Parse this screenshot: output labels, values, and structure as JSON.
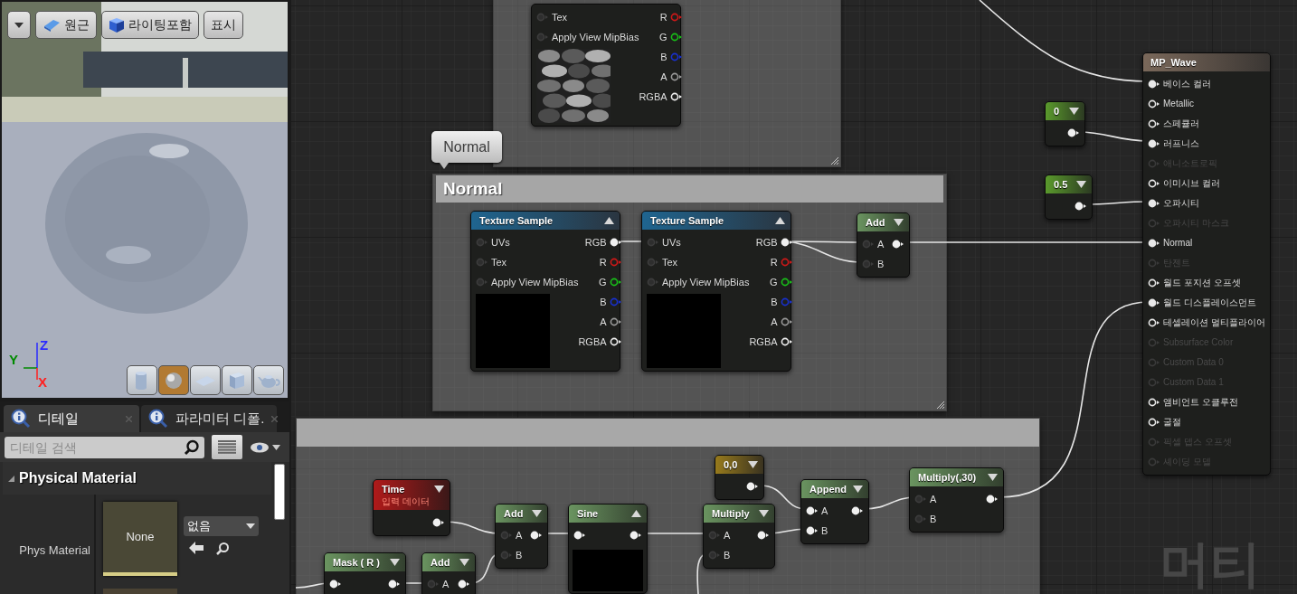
{
  "viewport": {
    "toolbar": [
      {
        "kind": "menu"
      },
      {
        "kind": "perspective",
        "label": "원근"
      },
      {
        "kind": "lit",
        "label": "라이팅포함"
      },
      {
        "kind": "show",
        "label": "표시"
      }
    ],
    "axes": [
      {
        "label": "Z",
        "color": "#2a2aff"
      },
      {
        "label": "Y",
        "color": "#008a00"
      },
      {
        "label": "X",
        "color": "#ff2020"
      }
    ],
    "preview_shapes": [
      {
        "kind": "cylinder",
        "selected": false
      },
      {
        "kind": "sphere",
        "selected": true
      },
      {
        "kind": "plane",
        "selected": false
      },
      {
        "kind": "cube",
        "selected": false
      },
      {
        "kind": "teapot",
        "selected": false
      }
    ]
  },
  "details": {
    "tabs": [
      {
        "label": "디테일",
        "selected": true
      },
      {
        "label": "파라미터 디폴.",
        "selected": false
      }
    ],
    "search": {
      "placeholder": "디테일 검색"
    },
    "section": {
      "title": "Physical Material",
      "expanded": true
    },
    "properties": [
      {
        "label": "Phys Material",
        "thumbnail": "None",
        "value": "없음"
      }
    ]
  },
  "graph": {
    "comments": [
      {
        "kind": "comment"
      },
      {
        "kind": "comment",
        "title": "Normal"
      },
      {
        "kind": "comment"
      }
    ],
    "bubble": "Normal",
    "nodes": [
      {
        "kind": "texture",
        "expanded": true,
        "inputs": [
          {
            "label": "Tex",
            "filled": false
          },
          {
            "label": "Apply View MipBias",
            "filled": false
          }
        ],
        "outputs": [
          {
            "label": "R",
            "filled": false,
            "color": "#d01818"
          },
          {
            "label": "G",
            "filled": false,
            "color": "#18c018"
          },
          {
            "label": "B",
            "filled": false,
            "color": "#1830d0"
          },
          {
            "label": "A",
            "filled": false,
            "color": "#9a9a9a"
          },
          {
            "label": "RGBA",
            "filled": false,
            "color": "#f0f0f0"
          }
        ]
      },
      {
        "kind": "texture",
        "title": "Texture Sample",
        "expanded": true,
        "inputs": [
          {
            "label": "UVs",
            "filled": false
          },
          {
            "label": "Tex",
            "filled": false
          },
          {
            "label": "Apply View MipBias",
            "filled": false
          }
        ],
        "outputs": [
          {
            "label": "RGB",
            "filled": true,
            "color": "#f0f0f0"
          },
          {
            "label": "R",
            "filled": false,
            "color": "#d01818"
          },
          {
            "label": "G",
            "filled": false,
            "color": "#18c018"
          },
          {
            "label": "B",
            "filled": false,
            "color": "#1830d0"
          },
          {
            "label": "A",
            "filled": false,
            "color": "#9a9a9a"
          },
          {
            "label": "RGBA",
            "filled": false,
            "color": "#f0f0f0"
          }
        ]
      },
      {
        "kind": "texture",
        "title": "Texture Sample",
        "expanded": true,
        "inputs": [
          {
            "label": "UVs",
            "filled": false
          },
          {
            "label": "Tex",
            "filled": false
          },
          {
            "label": "Apply View MipBias",
            "filled": false
          }
        ],
        "outputs": [
          {
            "label": "RGB",
            "filled": true,
            "color": "#f0f0f0"
          },
          {
            "label": "R",
            "filled": false,
            "color": "#d01818"
          },
          {
            "label": "G",
            "filled": false,
            "color": "#18c018"
          },
          {
            "label": "B",
            "filled": false,
            "color": "#1830d0"
          },
          {
            "label": "A",
            "filled": false,
            "color": "#9a9a9a"
          },
          {
            "label": "RGBA",
            "filled": false,
            "color": "#f0f0f0"
          }
        ]
      },
      {
        "kind": "math",
        "title": "Add",
        "expanded": false,
        "inputs": [
          {
            "label": "A",
            "filled": false
          },
          {
            "label": "B",
            "filled": false
          }
        ],
        "outputs": [
          {
            "filled": true
          }
        ]
      },
      {
        "kind": "constant",
        "title": "0",
        "expanded": false,
        "outputs": [
          {
            "filled": true
          }
        ]
      },
      {
        "kind": "constant",
        "title": "0.5",
        "expanded": false,
        "outputs": [
          {
            "filled": true
          }
        ]
      },
      {
        "kind": "result",
        "title": "MP_Wave",
        "inputs": [
          {
            "label": "베이스 컬러",
            "filled": true,
            "enabled": true
          },
          {
            "label": "Metallic",
            "filled": false,
            "enabled": true
          },
          {
            "label": "스페큘러",
            "filled": false,
            "enabled": true
          },
          {
            "label": "러프니스",
            "filled": true,
            "enabled": true
          },
          {
            "label": "애니소트로픽",
            "filled": false,
            "enabled": false
          },
          {
            "label": "이미시브 컬러",
            "filled": false,
            "enabled": true
          },
          {
            "label": "오파시티",
            "filled": true,
            "enabled": true
          },
          {
            "label": "오파시티 마스크",
            "filled": false,
            "enabled": false
          },
          {
            "label": "Normal",
            "filled": true,
            "enabled": true
          },
          {
            "label": "탄젠트",
            "filled": false,
            "enabled": false
          },
          {
            "label": "월드 포지션 오프셋",
            "filled": false,
            "enabled": true
          },
          {
            "label": "월드 디스플레이스먼트",
            "filled": true,
            "enabled": true
          },
          {
            "label": "테셀레이션 멀티플라이어",
            "filled": false,
            "enabled": true
          },
          {
            "label": "Subsurface Color",
            "filled": false,
            "enabled": false
          },
          {
            "label": "Custom Data 0",
            "filled": false,
            "enabled": false
          },
          {
            "label": "Custom Data 1",
            "filled": false,
            "enabled": false
          },
          {
            "label": "앰비언트 오클루전",
            "filled": false,
            "enabled": true
          },
          {
            "label": "굴절",
            "filled": false,
            "enabled": true
          },
          {
            "label": "픽셀 뎁스 오프셋",
            "filled": false,
            "enabled": false
          },
          {
            "label": "셰이딩 모델",
            "filled": false,
            "enabled": false
          }
        ]
      },
      {
        "kind": "input",
        "title": "Time",
        "subtitle": "입력 데이터",
        "expanded": false,
        "outputs": [
          {
            "filled": true
          }
        ]
      },
      {
        "kind": "math",
        "title": "Add",
        "expanded": false,
        "inputs": [
          {
            "label": "A",
            "filled": false
          },
          {
            "label": "B",
            "filled": false
          }
        ],
        "outputs": [
          {
            "filled": true
          }
        ]
      },
      {
        "kind": "math",
        "title": "Sine",
        "expanded": true,
        "inputs": [
          {
            "filled": true
          }
        ],
        "outputs": [
          {
            "filled": true
          }
        ]
      },
      {
        "kind": "vector",
        "title": "0,0",
        "expanded": false,
        "outputs": [
          {
            "filled": true
          }
        ]
      },
      {
        "kind": "math",
        "title": "Multiply",
        "expanded": false,
        "inputs": [
          {
            "label": "A",
            "filled": false
          },
          {
            "label": "B",
            "filled": false
          }
        ],
        "outputs": [
          {
            "filled": true
          }
        ]
      },
      {
        "kind": "math",
        "title": "Append",
        "expanded": false,
        "inputs": [
          {
            "label": "A",
            "filled": true
          },
          {
            "label": "B",
            "filled": true
          }
        ],
        "outputs": [
          {
            "filled": true
          }
        ]
      },
      {
        "kind": "math",
        "title": "Multiply(,30)",
        "expanded": false,
        "inputs": [
          {
            "label": "A",
            "filled": false
          },
          {
            "label": "B",
            "filled": false
          }
        ],
        "outputs": [
          {
            "filled": true
          }
        ]
      },
      {
        "kind": "math",
        "title": "Mask ( R )",
        "expanded": false,
        "inputs": [
          {
            "filled": true
          }
        ],
        "outputs": [
          {
            "filled": true
          }
        ]
      },
      {
        "kind": "math",
        "title": "Add",
        "expanded": false,
        "inputs": [
          {
            "label": "A",
            "filled": false
          }
        ],
        "outputs": [
          {
            "filled": true
          }
        ]
      }
    ],
    "graph_label": "머티"
  }
}
